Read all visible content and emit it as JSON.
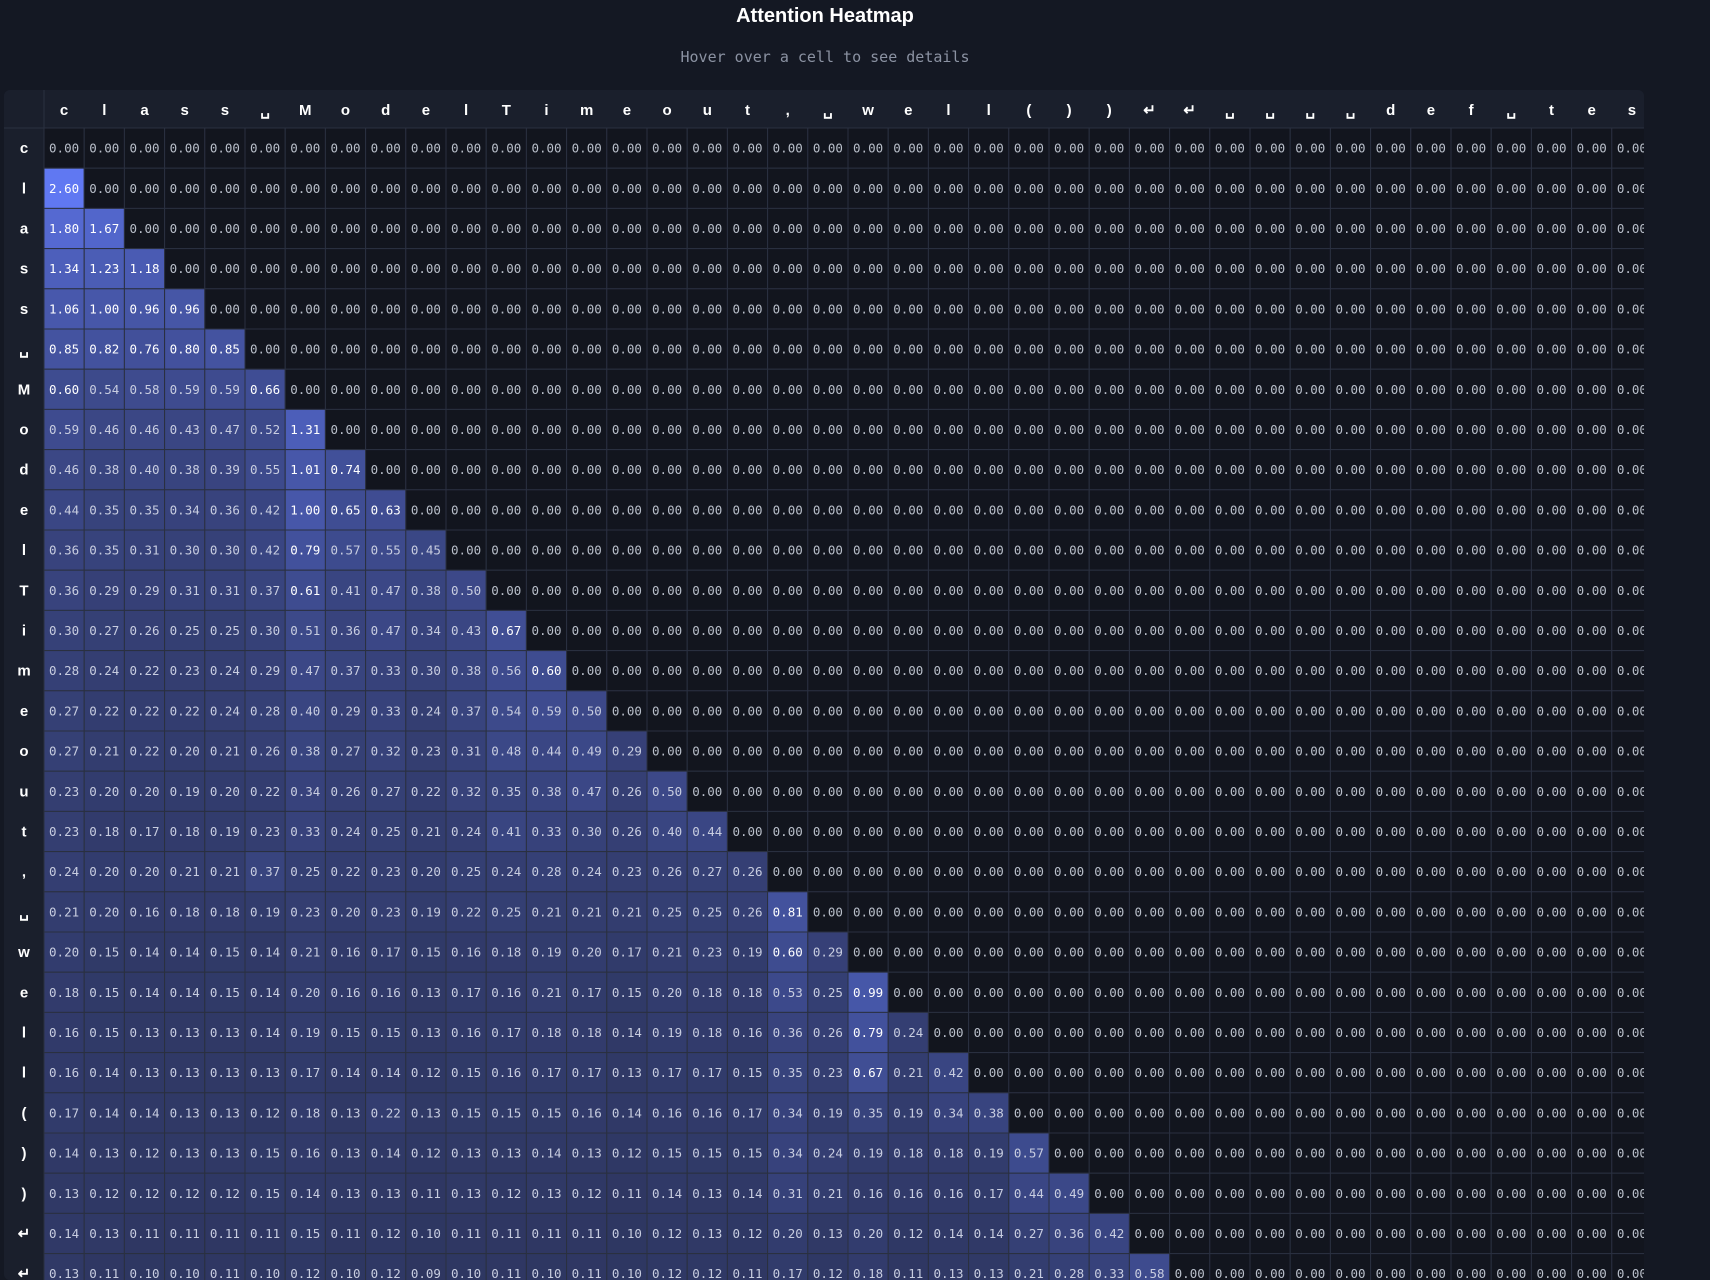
{
  "title": "Attention Heatmap",
  "subtitle": "Hover over a cell to see details",
  "chart_data": {
    "type": "heatmap",
    "x_tokens": [
      "c",
      "l",
      "a",
      "s",
      "s",
      "␣",
      "M",
      "o",
      "d",
      "e",
      "l",
      "T",
      "i",
      "m",
      "e",
      "o",
      "u",
      "t",
      ",",
      "␣",
      "w",
      "e",
      "l",
      "l",
      "(",
      ")",
      ")",
      "↵",
      "↵",
      "␣",
      "␣",
      "␣",
      "␣",
      "d",
      "e",
      "f",
      "␣",
      "t",
      "e",
      "s"
    ],
    "y_tokens": [
      "c",
      "l",
      "a",
      "s",
      "s",
      "␣",
      "M",
      "o",
      "d",
      "e",
      "l",
      "T",
      "i",
      "m",
      "e",
      "o",
      "u",
      "t",
      ",",
      "␣",
      "w",
      "e",
      "l",
      "l",
      "(",
      ")",
      ")",
      "↵",
      "↵"
    ],
    "values": [
      [
        0.0
      ],
      [
        2.6,
        0.0
      ],
      [
        1.8,
        1.67,
        0.0
      ],
      [
        1.34,
        1.23,
        1.18,
        0.0
      ],
      [
        1.06,
        1.0,
        0.96,
        0.96,
        0.0
      ],
      [
        0.85,
        0.82,
        0.76,
        0.8,
        0.85,
        0.0
      ],
      [
        0.6,
        0.54,
        0.58,
        0.59,
        0.59,
        0.66,
        0.0
      ],
      [
        0.59,
        0.46,
        0.46,
        0.43,
        0.47,
        0.52,
        1.31,
        0.0
      ],
      [
        0.46,
        0.38,
        0.4,
        0.38,
        0.39,
        0.55,
        1.01,
        0.74,
        0.0
      ],
      [
        0.44,
        0.35,
        0.35,
        0.34,
        0.36,
        0.42,
        1.0,
        0.65,
        0.63,
        0.0
      ],
      [
        0.36,
        0.35,
        0.31,
        0.3,
        0.3,
        0.42,
        0.79,
        0.57,
        0.55,
        0.45,
        0.0
      ],
      [
        0.36,
        0.29,
        0.29,
        0.31,
        0.31,
        0.37,
        0.61,
        0.41,
        0.47,
        0.38,
        0.5,
        0.0
      ],
      [
        0.3,
        0.27,
        0.26,
        0.25,
        0.25,
        0.3,
        0.51,
        0.36,
        0.47,
        0.34,
        0.43,
        0.67,
        0.0
      ],
      [
        0.28,
        0.24,
        0.22,
        0.23,
        0.24,
        0.29,
        0.47,
        0.37,
        0.33,
        0.3,
        0.38,
        0.56,
        0.6,
        0.0
      ],
      [
        0.27,
        0.22,
        0.22,
        0.22,
        0.24,
        0.28,
        0.4,
        0.29,
        0.33,
        0.24,
        0.37,
        0.54,
        0.59,
        0.5,
        0.0
      ],
      [
        0.27,
        0.21,
        0.22,
        0.2,
        0.21,
        0.26,
        0.38,
        0.27,
        0.32,
        0.23,
        0.31,
        0.48,
        0.44,
        0.49,
        0.29,
        0.0
      ],
      [
        0.23,
        0.2,
        0.2,
        0.19,
        0.2,
        0.22,
        0.34,
        0.26,
        0.27,
        0.22,
        0.32,
        0.35,
        0.38,
        0.47,
        0.26,
        0.5,
        0.0
      ],
      [
        0.23,
        0.18,
        0.17,
        0.18,
        0.19,
        0.23,
        0.33,
        0.24,
        0.25,
        0.21,
        0.24,
        0.41,
        0.33,
        0.3,
        0.26,
        0.4,
        0.44,
        0.0
      ],
      [
        0.24,
        0.2,
        0.2,
        0.21,
        0.21,
        0.37,
        0.25,
        0.22,
        0.23,
        0.2,
        0.25,
        0.24,
        0.28,
        0.24,
        0.23,
        0.26,
        0.27,
        0.26,
        0.0
      ],
      [
        0.21,
        0.2,
        0.16,
        0.18,
        0.18,
        0.19,
        0.23,
        0.2,
        0.23,
        0.19,
        0.22,
        0.25,
        0.21,
        0.21,
        0.21,
        0.25,
        0.25,
        0.26,
        0.81,
        0.0
      ],
      [
        0.2,
        0.15,
        0.14,
        0.14,
        0.15,
        0.14,
        0.21,
        0.16,
        0.17,
        0.15,
        0.16,
        0.18,
        0.19,
        0.2,
        0.17,
        0.21,
        0.23,
        0.19,
        0.6,
        0.29,
        0.0
      ],
      [
        0.18,
        0.15,
        0.14,
        0.14,
        0.15,
        0.14,
        0.2,
        0.16,
        0.16,
        0.13,
        0.17,
        0.16,
        0.21,
        0.17,
        0.15,
        0.2,
        0.18,
        0.18,
        0.53,
        0.25,
        0.99,
        0.0
      ],
      [
        0.16,
        0.15,
        0.13,
        0.13,
        0.13,
        0.14,
        0.19,
        0.15,
        0.15,
        0.13,
        0.16,
        0.17,
        0.18,
        0.18,
        0.14,
        0.19,
        0.18,
        0.16,
        0.36,
        0.26,
        0.79,
        0.24,
        0.0
      ],
      [
        0.16,
        0.14,
        0.13,
        0.13,
        0.13,
        0.13,
        0.17,
        0.14,
        0.14,
        0.12,
        0.15,
        0.16,
        0.17,
        0.17,
        0.13,
        0.17,
        0.17,
        0.15,
        0.35,
        0.23,
        0.67,
        0.21,
        0.42,
        0.0
      ],
      [
        0.17,
        0.14,
        0.14,
        0.13,
        0.13,
        0.12,
        0.18,
        0.13,
        0.22,
        0.13,
        0.15,
        0.15,
        0.15,
        0.16,
        0.14,
        0.16,
        0.16,
        0.17,
        0.34,
        0.19,
        0.35,
        0.19,
        0.34,
        0.38,
        0.0
      ],
      [
        0.14,
        0.13,
        0.12,
        0.13,
        0.13,
        0.15,
        0.16,
        0.13,
        0.14,
        0.12,
        0.13,
        0.13,
        0.14,
        0.13,
        0.12,
        0.15,
        0.15,
        0.15,
        0.34,
        0.24,
        0.19,
        0.18,
        0.18,
        0.19,
        0.57,
        0.0
      ],
      [
        0.13,
        0.12,
        0.12,
        0.12,
        0.12,
        0.15,
        0.14,
        0.13,
        0.13,
        0.11,
        0.13,
        0.12,
        0.13,
        0.12,
        0.11,
        0.14,
        0.13,
        0.14,
        0.31,
        0.21,
        0.16,
        0.16,
        0.16,
        0.17,
        0.44,
        0.49,
        0.0
      ],
      [
        0.14,
        0.13,
        0.11,
        0.11,
        0.11,
        0.11,
        0.15,
        0.11,
        0.12,
        0.1,
        0.11,
        0.11,
        0.11,
        0.11,
        0.1,
        0.12,
        0.13,
        0.12,
        0.2,
        0.13,
        0.2,
        0.12,
        0.14,
        0.14,
        0.27,
        0.36,
        0.42,
        0.0
      ],
      [
        0.13,
        0.11,
        0.1,
        0.1,
        0.11,
        0.1,
        0.12,
        0.1,
        0.12,
        0.09,
        0.1,
        0.11,
        0.1,
        0.11,
        0.1,
        0.12,
        0.12,
        0.11,
        0.17,
        0.12,
        0.18,
        0.11,
        0.13,
        0.13,
        0.21,
        0.28,
        0.33,
        0.58,
        0.0
      ]
    ],
    "vmin": 0,
    "vmax": 2.6,
    "colors": {
      "zero": "#12151e",
      "low": "#262c4a",
      "high": "#6078f2"
    }
  }
}
